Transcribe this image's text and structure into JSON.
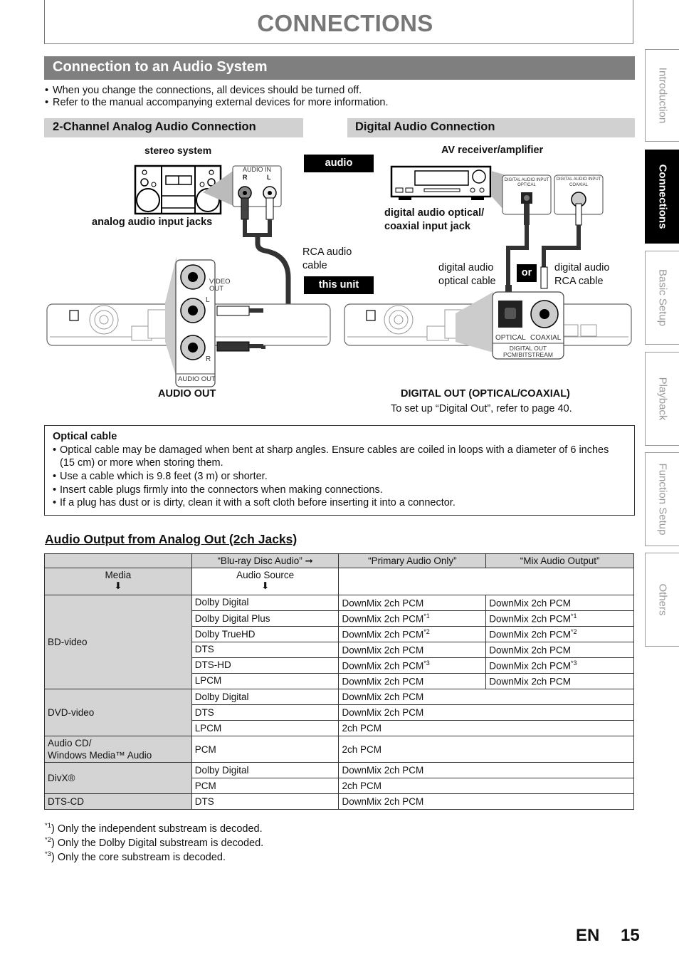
{
  "header": {
    "title": "CONNECTIONS"
  },
  "section": {
    "title": "Connection to an Audio System",
    "bullets": [
      "When you change the connections, all devices should be turned off.",
      "Refer to the manual accompanying external devices for more information."
    ]
  },
  "analog": {
    "title": "2-Channel Analog Audio Connection",
    "device_label": "stereo system",
    "jack_label": "analog audio input jacks",
    "audio_in_label": "AUDIO IN",
    "r_label": "R",
    "l_label": "L",
    "cable_label_line1": "RCA audio",
    "cable_label_line2": "cable",
    "video_out_line1": "VIDEO",
    "video_out_line2": "OUT",
    "panel_l": "L",
    "panel_r": "R",
    "panel_audio_out": "AUDIO OUT",
    "output_label": "AUDIO OUT"
  },
  "digital": {
    "title": "Digital Audio Connection",
    "device_label": "AV receiver/amplifier",
    "jack_label_line1": "digital audio optical/",
    "jack_label_line2": "coaxial input jack",
    "optical_input_line1": "DIGITAL AUDIO INPUT",
    "optical_input_line2": "OPTICAL",
    "coaxial_input_line1": "DIGITAL AUDIO INPUT",
    "coaxial_input_line2": "COAXIAL",
    "optical_cable_line1": "digital audio",
    "optical_cable_line2": "optical cable",
    "rca_cable_line1": "digital audio",
    "rca_cable_line2": "RCA cable",
    "or_tag": "or",
    "panel_optical": "OPTICAL",
    "panel_coaxial": "COAXIAL",
    "panel_digital_out_line1": "DIGITAL OUT",
    "panel_digital_out_line2": "PCM/BITSTREAM",
    "output_label": "DIGITAL OUT (OPTICAL/COAXIAL)",
    "output_note": "To set up “Digital Out”, refer to page 40."
  },
  "tags": {
    "audio": "audio",
    "this_unit": "this unit"
  },
  "optical_note": {
    "title": "Optical cable",
    "items": [
      "Optical cable may be damaged when bent at sharp angles. Ensure cables are coiled in loops with a diameter of 6 inches (15 cm) or more when storing them.",
      "Use a cable which is 9.8 feet (3 m) or shorter.",
      "Insert cable plugs firmly into the connectors when making connections.",
      "If a plug has dust or is dirty, clean it with a soft cloth before inserting it into a connector."
    ]
  },
  "table": {
    "heading": "Audio Output from Analog Out (2ch Jacks)",
    "header_setting": "“Blu-ray Disc Audio” ➞",
    "header_primary": "“Primary Audio Only”",
    "header_mix": "“Mix Audio Output”",
    "media_label": "Media",
    "source_label": "Audio Source",
    "down_arrow": "⬇",
    "bd": {
      "media": "BD-video",
      "rows": [
        {
          "source": "Dolby Digital",
          "primary": "DownMix 2ch PCM",
          "primary_note": "",
          "mix": "DownMix 2ch PCM",
          "mix_note": ""
        },
        {
          "source": "Dolby Digital Plus",
          "primary": "DownMix 2ch PCM",
          "primary_note": "*1",
          "mix": "DownMix 2ch PCM",
          "mix_note": "*1"
        },
        {
          "source": "Dolby TrueHD",
          "primary": "DownMix 2ch PCM",
          "primary_note": "*2",
          "mix": "DownMix 2ch PCM",
          "mix_note": "*2"
        },
        {
          "source": "DTS",
          "primary": "DownMix 2ch PCM",
          "primary_note": "",
          "mix": "DownMix 2ch PCM",
          "mix_note": ""
        },
        {
          "source": "DTS-HD",
          "primary": "DownMix 2ch PCM",
          "primary_note": "*3",
          "mix": "DownMix 2ch PCM",
          "mix_note": "*3"
        },
        {
          "source": "LPCM",
          "primary": "DownMix 2ch PCM",
          "primary_note": "",
          "mix": "DownMix 2ch PCM",
          "mix_note": ""
        }
      ]
    },
    "dvd": {
      "media": "DVD-video",
      "rows": [
        {
          "source": "Dolby Digital",
          "output": "DownMix 2ch PCM"
        },
        {
          "source": "DTS",
          "output": "DownMix 2ch PCM"
        },
        {
          "source": "LPCM",
          "output": "2ch PCM"
        }
      ]
    },
    "cd": {
      "media_line1": "Audio CD/",
      "media_line2": "Windows Media™ Audio",
      "source": "PCM",
      "output": "2ch PCM"
    },
    "divx": {
      "media": "DivX®",
      "rows": [
        {
          "source": "Dolby Digital",
          "output": "DownMix 2ch PCM"
        },
        {
          "source": "PCM",
          "output": "2ch PCM"
        }
      ]
    },
    "dtscd": {
      "media": "DTS-CD",
      "source": "DTS",
      "output": "DownMix 2ch PCM"
    }
  },
  "footnotes": [
    {
      "mark": "*1",
      "text": ") Only the independent substream is decoded."
    },
    {
      "mark": "*2",
      "text": ") Only the Dolby Digital substream is decoded."
    },
    {
      "mark": "*3",
      "text": ") Only the core substream is decoded."
    }
  ],
  "side_tabs": [
    {
      "label": "Introduction",
      "active": false
    },
    {
      "label": "Connections",
      "active": true
    },
    {
      "label": "Basic Setup",
      "active": false
    },
    {
      "label": "Playback",
      "active": false
    },
    {
      "label": "Function Setup",
      "active": false
    },
    {
      "label": "Others",
      "active": false
    }
  ],
  "footer": {
    "language": "EN",
    "page_number": "15"
  }
}
